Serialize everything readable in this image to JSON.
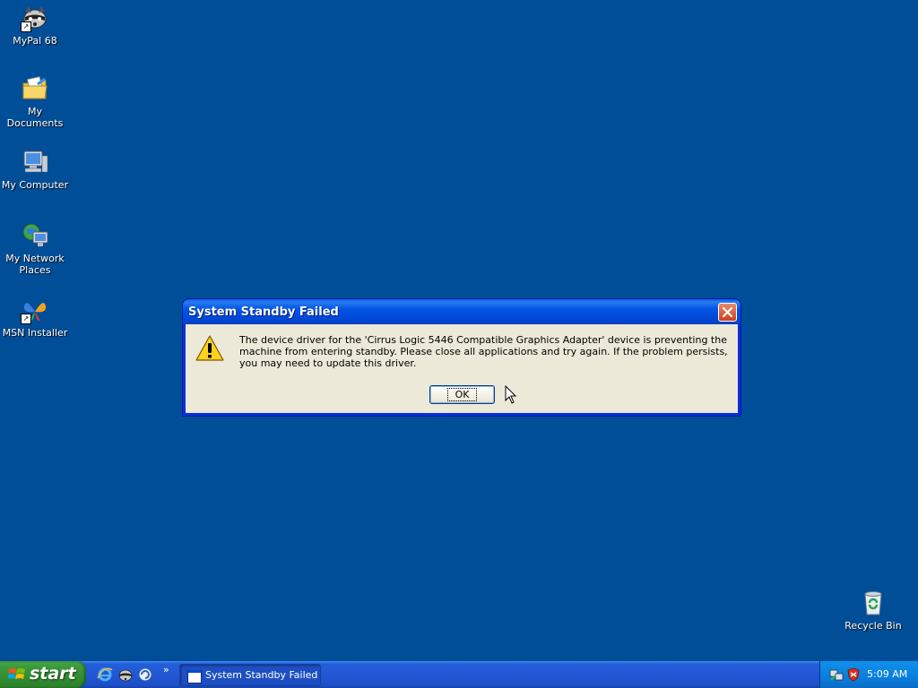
{
  "desktop": {
    "background_color": "#004e98",
    "icons": [
      {
        "label": "MyPal 68",
        "icon": "raccoon-icon"
      },
      {
        "label": "My Documents",
        "icon": "documents-folder-icon"
      },
      {
        "label": "My Computer",
        "icon": "computer-icon"
      },
      {
        "label": "My Network Places",
        "icon": "network-icon"
      },
      {
        "label": "MSN Installer",
        "icon": "msn-butterfly-icon"
      },
      {
        "label": "Recycle Bin",
        "icon": "recycle-bin-icon"
      }
    ]
  },
  "dialog": {
    "title": "System Standby Failed",
    "message": "The device driver for the 'Cirrus Logic 5446 Compatible Graphics Adapter' device is preventing the machine from entering standby. Please close all applications and try again. If the problem persists, you may need to update this driver.",
    "ok_label": "OK",
    "icon": "warning-icon"
  },
  "taskbar": {
    "start_label": "start",
    "quick_launch": [
      "internet-explorer-icon",
      "raccoon-icon",
      "refresh-icon"
    ],
    "quick_launch_more": "»",
    "tasks": [
      {
        "label": "System Standby Failed",
        "active": true
      }
    ],
    "tray": {
      "icons": [
        "network-tray-icon",
        "security-shield-icon"
      ],
      "clock": "5:09 AM"
    }
  }
}
